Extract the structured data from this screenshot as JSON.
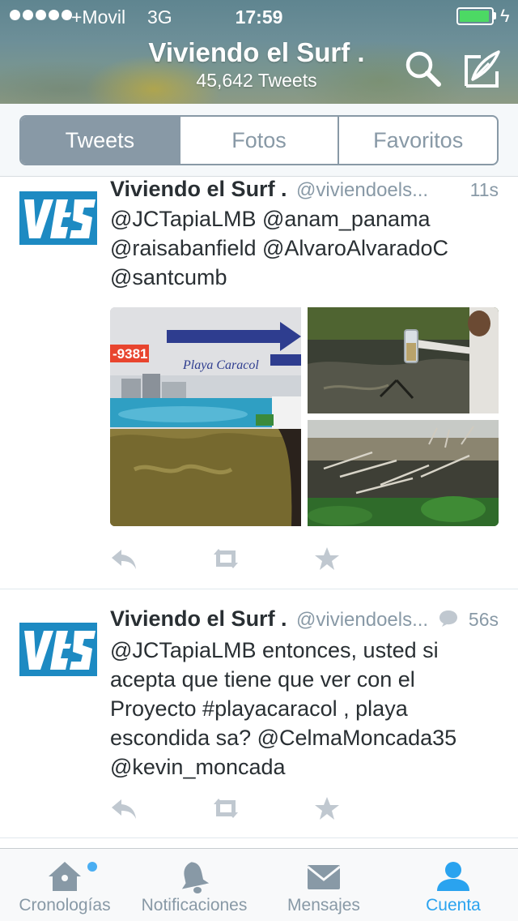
{
  "status_bar": {
    "carrier": "+Movil",
    "network": "3G",
    "time": "17:59",
    "battery_color": "#4cd964"
  },
  "header": {
    "name": "Viviendo el Surf .",
    "tweet_count": "45,642 Tweets",
    "search_icon": "search-icon",
    "compose_icon": "compose-icon"
  },
  "segments": [
    {
      "label": "Tweets",
      "active": true
    },
    {
      "label": "Fotos",
      "active": false
    },
    {
      "label": "Favoritos",
      "active": false
    }
  ],
  "tweets": [
    {
      "name": "Viviendo el Surf .",
      "handle": "@viviendoels...",
      "time": "11s",
      "lines": [
        "@JCTapiaLMB @anam_panama",
        "@raisabanfield @AlvaroAlvaradoC",
        "@santcumb"
      ],
      "has_media": true,
      "media_text": {
        "phone": "-9381",
        "brand": "Playa Caracol"
      }
    },
    {
      "name": "Viviendo el Surf .",
      "handle": "@viviendoels...",
      "time": "56s",
      "has_reply_icon": true,
      "lines": [
        "@JCTapiaLMB entonces, usted si",
        "acepta que tiene que ver con el",
        "Proyecto #playacaracol , playa",
        "escondida sa? @CelmaMoncada35",
        "@kevin_moncada"
      ]
    }
  ],
  "tabbar": [
    {
      "label": "Cronologías",
      "icon": "home-icon",
      "active": false
    },
    {
      "label": "Notificaciones",
      "icon": "bell-icon",
      "active": false
    },
    {
      "label": "Mensajes",
      "icon": "envelope-icon",
      "active": false
    },
    {
      "label": "Cuenta",
      "icon": "person-icon",
      "active": true
    }
  ],
  "colors": {
    "accent": "#2aa3ef",
    "muted": "#8899a6",
    "avatar_blue": "#1d8ac2"
  }
}
